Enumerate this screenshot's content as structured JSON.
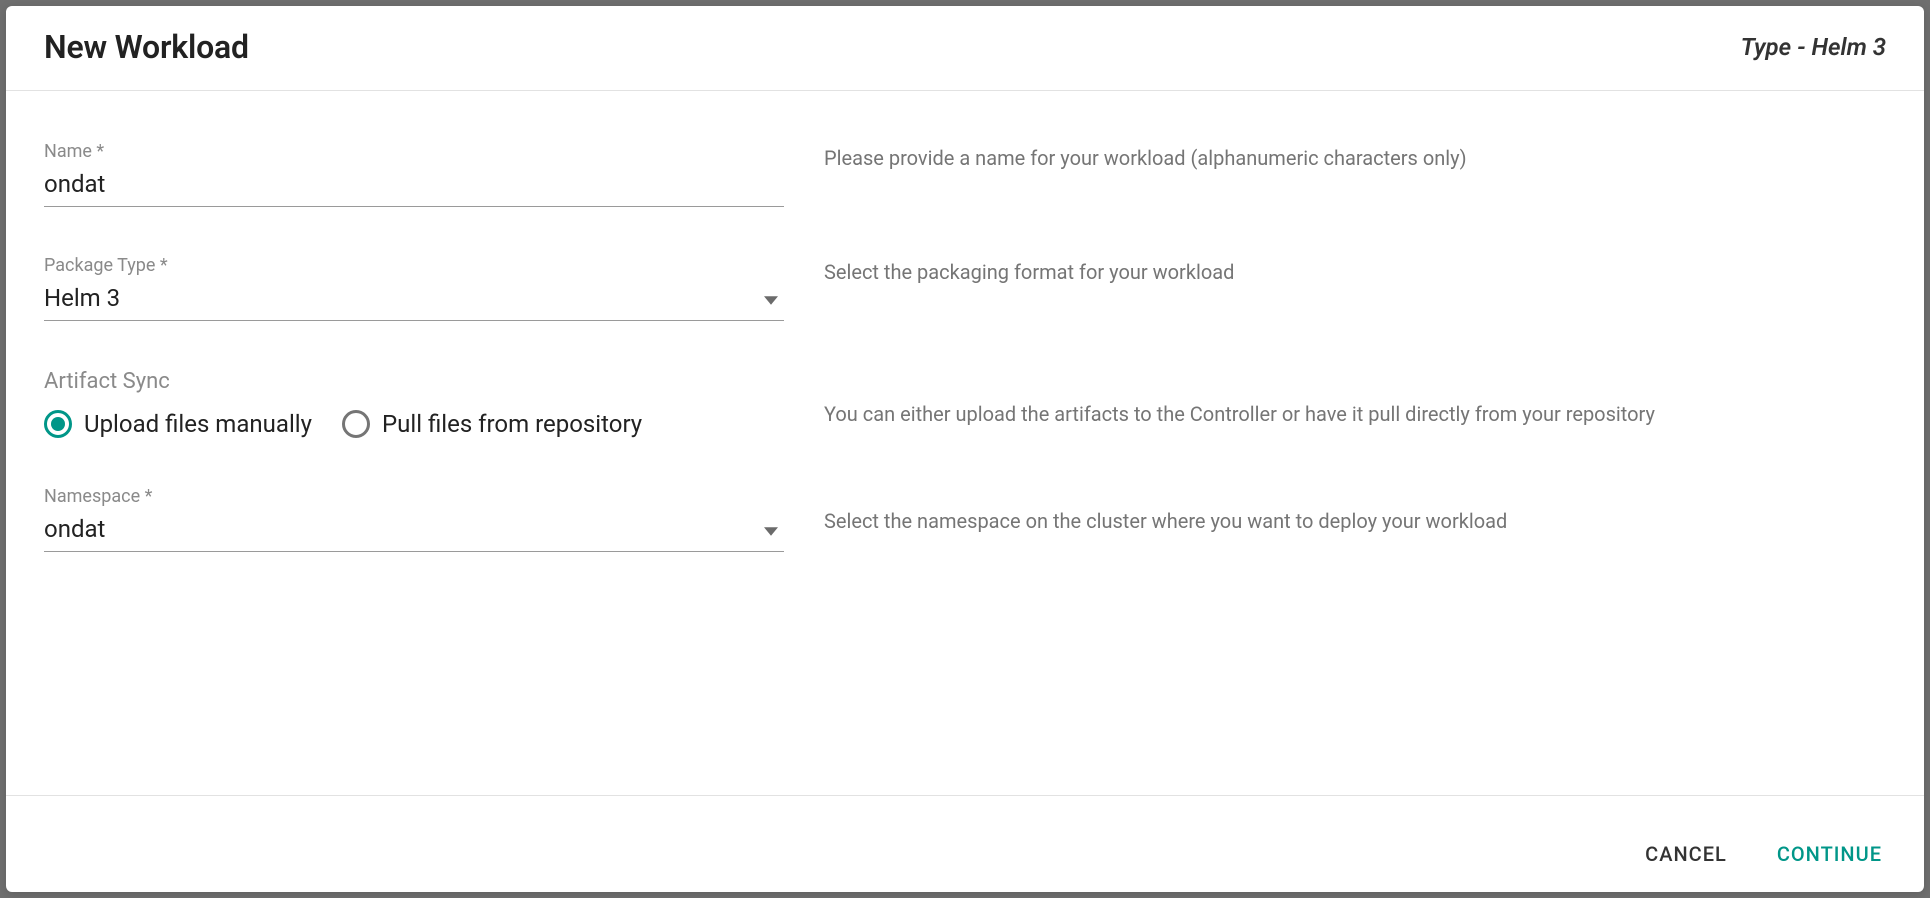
{
  "header": {
    "title": "New Workload",
    "type_label": "Type - Helm 3"
  },
  "fields": {
    "name": {
      "label": "Name *",
      "value": "ondat",
      "help": "Please provide a name for your workload (alphanumeric characters only)"
    },
    "package_type": {
      "label": "Package Type *",
      "value": "Helm 3",
      "help": "Select the packaging format for your workload"
    },
    "artifact_sync": {
      "label": "Artifact Sync",
      "option_upload": "Upload files manually",
      "option_pull": "Pull files from repository",
      "selected": "upload",
      "help": "You can either upload the artifacts to the Controller or have it pull directly from your repository"
    },
    "namespace": {
      "label": "Namespace *",
      "value": "ondat",
      "help": "Select the namespace on the cluster where you want to deploy your workload"
    }
  },
  "footer": {
    "cancel": "CANCEL",
    "continue": "CONTINUE"
  }
}
